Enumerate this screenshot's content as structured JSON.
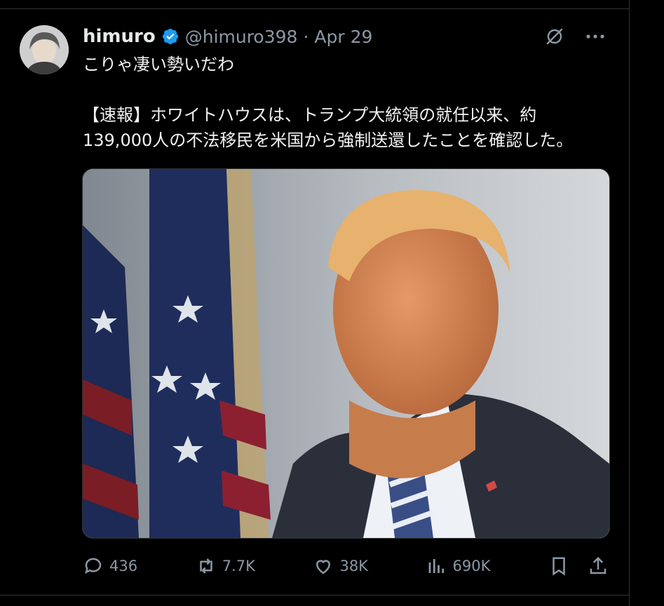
{
  "tweet": {
    "author_name": "himuro",
    "author_handle": "@himuro398",
    "separator": "·",
    "date": "Apr 29",
    "text": "こりゃ凄い勢いだわ\n\n【速報】ホワイトハウスは、トランプ大統領の就任以来、約\n139,000人の不法移民を米国から強制送還したことを確認した。",
    "verified_color": "#1d9bf0"
  },
  "metrics": {
    "replies": "436",
    "reposts": "7.7K",
    "likes": "38K",
    "views": "690K"
  },
  "icons": {
    "grok": "grok-icon",
    "more": "more-icon",
    "reply": "reply-icon",
    "repost": "repost-icon",
    "like": "heart-icon",
    "views": "views-icon",
    "bookmark": "bookmark-icon",
    "share": "share-icon"
  }
}
